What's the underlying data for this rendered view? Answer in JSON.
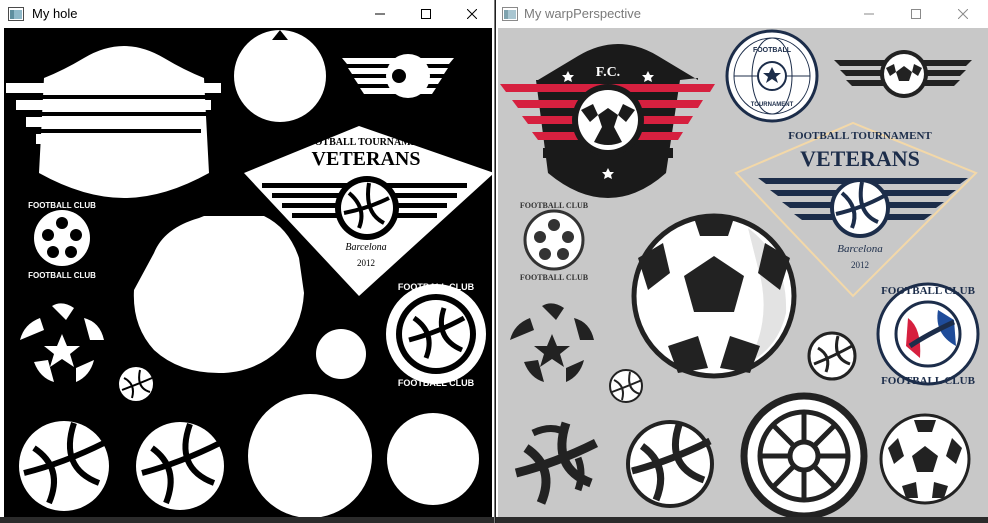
{
  "windows": {
    "left": {
      "title": "My hole"
    },
    "right": {
      "title": "My warpPerspective"
    }
  },
  "logos": {
    "fc": "F.C.",
    "football": "FOOTBALL",
    "tournament": "TOURNAMENT",
    "football_tournament": "FOOTBALL TOURNAMENT",
    "veterans": "VETERANS",
    "barcelona": "Barcelona",
    "year": "2012",
    "football_club": "FOOTBALL CLUB"
  },
  "colors": {
    "hole_bg": "#000000",
    "warp_bg": "#c8c8c8",
    "red": "#d6203f",
    "navy": "#1c2d4a",
    "dark": "#222222",
    "blue": "#1f4c9a",
    "gold": "#f3d8a8"
  },
  "icons": [
    "window-app-icon",
    "minimize-icon",
    "maximize-icon",
    "close-icon"
  ]
}
